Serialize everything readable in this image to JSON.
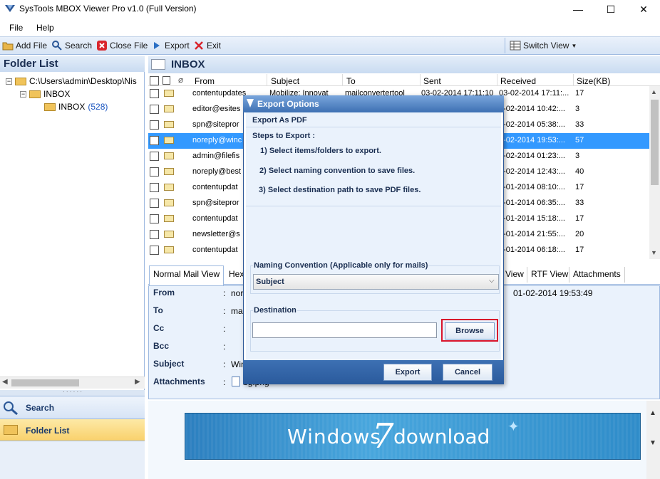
{
  "window": {
    "title": "SysTools MBOX Viewer Pro v1.0 (Full Version)",
    "minimize": "—",
    "maximize": "☐",
    "close": "✕"
  },
  "menu": {
    "file": "File",
    "help": "Help"
  },
  "toolbar": {
    "add_file": "Add File",
    "search": "Search",
    "close_file": "Close File",
    "export": "Export",
    "exit": "Exit",
    "switch_view": "Switch View"
  },
  "folder_list": {
    "title": "Folder List",
    "root_path": "C:\\Users\\admin\\Desktop\\Nis",
    "inbox_parent": "INBOX",
    "inbox_child": "INBOX",
    "inbox_count": "(528)"
  },
  "nav": {
    "search": "Search",
    "folder_list": "Folder List"
  },
  "inbox": {
    "title": "INBOX",
    "columns": [
      "From",
      "Subject",
      "To",
      "Sent",
      "Received",
      "Size(KB)"
    ],
    "rows": [
      {
        "from": "contentupdates",
        "subject": "Mobilize: Innovat",
        "to": "mailconvertertool",
        "sent": "03-02-2014 17:11:10",
        "received": "03-02-2014 17:11:...",
        "size": "17"
      },
      {
        "from": "editor@esites",
        "subject": "",
        "to": "",
        "sent": "",
        "received": "3-02-2014 10:42:...",
        "size": "3"
      },
      {
        "from": "spn@sitepror",
        "subject": "",
        "to": "",
        "sent": "",
        "received": "3-02-2014 05:38:...",
        "size": "33"
      },
      {
        "from": "noreply@winc",
        "subject": "",
        "to": "",
        "sent": "",
        "received": "1-02-2014 19:53:...",
        "size": "57"
      },
      {
        "from": "admin@filefis",
        "subject": "",
        "to": "",
        "sent": "",
        "received": "1-02-2014 01:23:...",
        "size": "3"
      },
      {
        "from": "noreply@best",
        "subject": "",
        "to": "",
        "sent": "",
        "received": "1-02-2014 12:43:...",
        "size": "40"
      },
      {
        "from": "contentupdat",
        "subject": "",
        "to": "",
        "sent": "",
        "received": "1-01-2014 08:10:...",
        "size": "17"
      },
      {
        "from": "spn@sitepror",
        "subject": "",
        "to": "",
        "sent": "",
        "received": "1-01-2014 06:35:...",
        "size": "33"
      },
      {
        "from": "contentupdat",
        "subject": "",
        "to": "",
        "sent": "",
        "received": "0-01-2014 15:18:...",
        "size": "17"
      },
      {
        "from": "newsletter@s",
        "subject": "",
        "to": "",
        "sent": "",
        "received": "0-01-2014 21:55:...",
        "size": "20"
      },
      {
        "from": "contentupdat",
        "subject": "",
        "to": "",
        "sent": "",
        "received": "9-01-2014 06:18:...",
        "size": "17"
      }
    ],
    "selected_row": 3
  },
  "tabs": {
    "normal": "Normal Mail View",
    "hex": "Hex",
    "view": "View",
    "rtf": "RTF View",
    "attachments": "Attachments"
  },
  "preview": {
    "from_label": "From",
    "to_label": "To",
    "cc_label": "Cc",
    "bcc_label": "Bcc",
    "subject_label": "Subject",
    "attachments_label": "Attachments",
    "colon": ":",
    "from_value": "nor",
    "to_value": "ma",
    "subject_value": "Win",
    "attachment_file": "bg.png",
    "date_value": "01-02-2014 19:53:49",
    "banner_windows": "Windows",
    "banner_seven": "7",
    "banner_download": "download"
  },
  "dialog": {
    "title": "Export Options",
    "section": "Export As PDF",
    "steps_title": "Steps to Export :",
    "step1": "1) Select items/folders to export.",
    "step2": "2) Select naming convention to save files.",
    "step3": "3) Select destination path to save PDF files.",
    "naming_label": "Naming Convention (Applicable only for mails)",
    "naming_value": "Subject",
    "destination_label": "Destination",
    "destination_value": "",
    "browse": "Browse",
    "export": "Export",
    "cancel": "Cancel"
  },
  "colors": {
    "accent": "#3399ff",
    "dialog_title": "#3d70b3",
    "highlight_border": "#d9142b",
    "nav_selected": "#f9d16c"
  }
}
